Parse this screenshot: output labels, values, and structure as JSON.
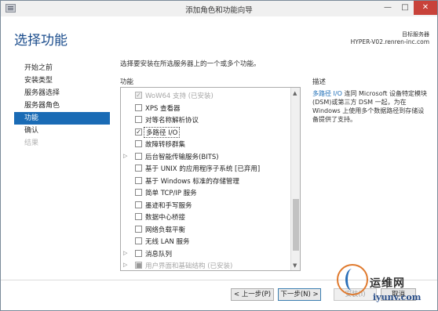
{
  "window": {
    "title": "添加角色和功能向导",
    "controls": {
      "minimize": "—",
      "maximize": "□",
      "close": "✕"
    }
  },
  "page": {
    "title": "选择功能",
    "target_label": "目标服务器",
    "target_server": "HYPER-V02.renren-inc.com",
    "instruction": "选择要安装在所选服务器上的一个或多个功能。",
    "features_heading": "功能",
    "description_heading": "描述"
  },
  "sidebar": {
    "items": [
      {
        "label": "开始之前",
        "state": "normal"
      },
      {
        "label": "安装类型",
        "state": "normal"
      },
      {
        "label": "服务器选择",
        "state": "normal"
      },
      {
        "label": "服务器角色",
        "state": "normal"
      },
      {
        "label": "功能",
        "state": "active"
      },
      {
        "label": "确认",
        "state": "normal"
      },
      {
        "label": "结果",
        "state": "disabled"
      }
    ]
  },
  "features": [
    {
      "label": "WoW64 支持 (已安装)",
      "checked": true,
      "disabled": true,
      "expandable": false
    },
    {
      "label": "XPS 查看器",
      "checked": false,
      "disabled": false,
      "expandable": false
    },
    {
      "label": "对等名称解析协议",
      "checked": false,
      "disabled": false,
      "expandable": false
    },
    {
      "label": "多路径 I/O",
      "checked": true,
      "disabled": false,
      "expandable": false,
      "selected": true
    },
    {
      "label": "故障转移群集",
      "checked": false,
      "disabled": false,
      "expandable": false
    },
    {
      "label": "后台智能传输服务(BITS)",
      "checked": false,
      "disabled": false,
      "expandable": true
    },
    {
      "label": "基于 UNIX 的应用程序子系统 [已弃用]",
      "checked": false,
      "disabled": false,
      "expandable": false
    },
    {
      "label": "基于 Windows 标准的存储管理",
      "checked": false,
      "disabled": false,
      "expandable": false
    },
    {
      "label": "简单 TCP/IP 服务",
      "checked": false,
      "disabled": false,
      "expandable": false
    },
    {
      "label": "墨迹和手写服务",
      "checked": false,
      "disabled": false,
      "expandable": false
    },
    {
      "label": "数据中心桥接",
      "checked": false,
      "disabled": false,
      "expandable": false
    },
    {
      "label": "网络负载平衡",
      "checked": false,
      "disabled": false,
      "expandable": false
    },
    {
      "label": "无线 LAN 服务",
      "checked": false,
      "disabled": false,
      "expandable": false
    },
    {
      "label": "消息队列",
      "checked": false,
      "disabled": false,
      "expandable": true
    },
    {
      "label": "用户界面和基础结构 (已安装)",
      "checked": true,
      "disabled": true,
      "expandable": true,
      "partial": true
    }
  ],
  "description": {
    "term": "多路径 I/O",
    "text": " 连同 Microsoft 设备特定模块(DSM)或第三方 DSM 一起，为在 Windows 上使用多个数据路径到存储设备提供了支持。"
  },
  "buttons": {
    "prev": "< 上一步(P)",
    "next": "下一步(N) >",
    "install": "安装(I)",
    "cancel": "取消"
  },
  "watermark": {
    "brand": "运维网",
    "domain": "iyunv.com"
  },
  "colors": {
    "accent": "#1a6bb5",
    "title": "#1a4c8c",
    "close_button": "#c8423a"
  },
  "icons": {
    "expander": "▷",
    "check": "✓",
    "partial": "■",
    "scroll_up": "▲",
    "scroll_down": "▼"
  }
}
